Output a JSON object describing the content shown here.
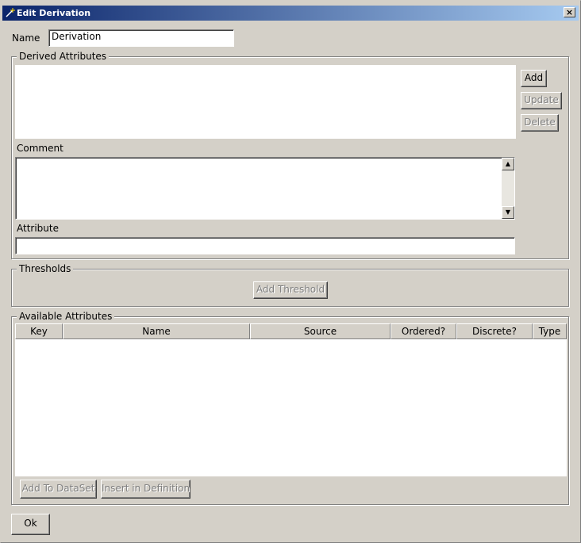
{
  "window": {
    "title": "Edit Derivation",
    "close_glyph": "×"
  },
  "name": {
    "label": "Name",
    "value": "Derivation"
  },
  "derived_attributes": {
    "group_title": "Derived Attributes",
    "add_label": "Add",
    "update_label": "Update",
    "delete_label": "Delete",
    "comment_label": "Comment",
    "comment_value": "",
    "attribute_label": "Attribute",
    "attribute_value": ""
  },
  "thresholds": {
    "group_title": "Thresholds",
    "add_threshold_label": "Add Threshold"
  },
  "available_attributes": {
    "group_title": "Available Attributes",
    "columns": [
      "Key",
      "Name",
      "Source",
      "Ordered?",
      "Discrete?",
      "Type"
    ],
    "rows": [],
    "add_to_dataset_label": "Add To DataSet",
    "insert_in_definition_label": "Insert in Definition"
  },
  "ok_label": "Ok",
  "icons": {
    "title": "wand-icon",
    "scroll_up": "up-arrow",
    "scroll_down": "down-arrow"
  },
  "colors": {
    "title_start": "#0a246a",
    "title_end": "#a6caf0",
    "face": "#d4d0c8"
  }
}
